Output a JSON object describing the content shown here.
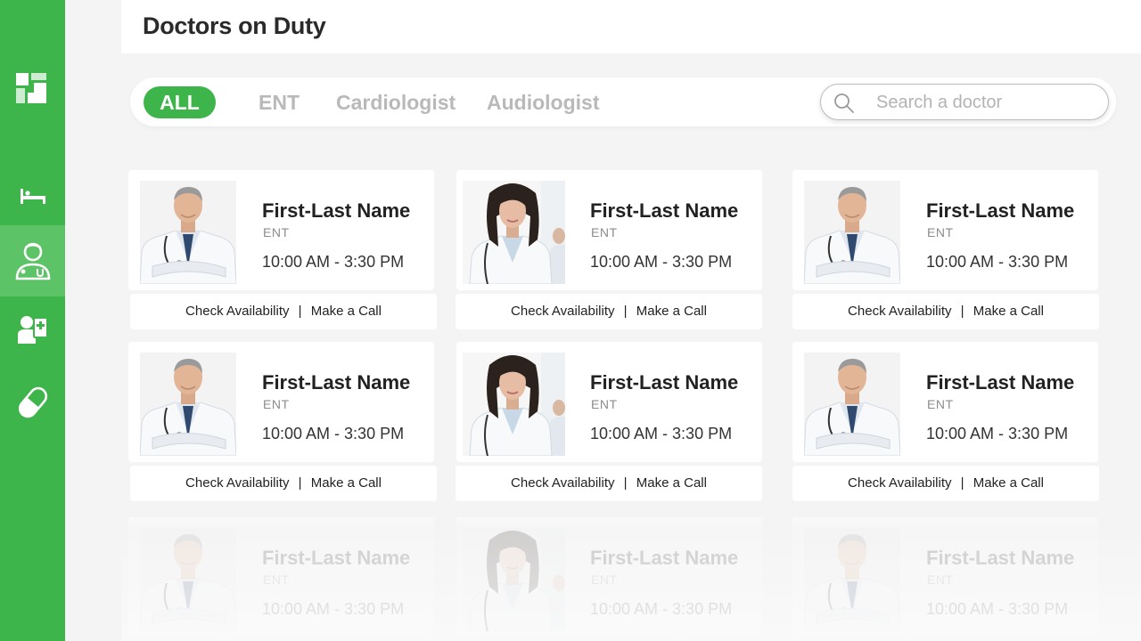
{
  "header": {
    "title": "Doctors on Duty"
  },
  "sidebar": {
    "logo": "app-logo-icon",
    "items": [
      {
        "name": "bed",
        "icon": "bed-icon",
        "active": false
      },
      {
        "name": "doctors",
        "icon": "doctor-icon",
        "active": true
      },
      {
        "name": "patients",
        "icon": "patient-record-icon",
        "active": false
      },
      {
        "name": "medicine",
        "icon": "pill-icon",
        "active": false
      }
    ]
  },
  "filters": {
    "tabs": [
      "ALL",
      "ENT",
      "Cardiologist",
      "Audiologist"
    ],
    "active_tab": "ALL",
    "search_placeholder": "Search a doctor",
    "search_value": ""
  },
  "doctors": [
    {
      "name": "First-Last Name",
      "specialty": "ENT",
      "hours": "10:00 AM - 3:30 PM",
      "photo": "male-doctor-photo"
    },
    {
      "name": "First-Last Name",
      "specialty": "ENT",
      "hours": "10:00 AM - 3:30 PM",
      "photo": "female-doctor-photo"
    },
    {
      "name": "First-Last Name",
      "specialty": "ENT",
      "hours": "10:00 AM - 3:30 PM",
      "photo": "male-doctor-photo"
    },
    {
      "name": "First-Last Name",
      "specialty": "ENT",
      "hours": "10:00 AM - 3:30 PM",
      "photo": "male-doctor-photo"
    },
    {
      "name": "First-Last Name",
      "specialty": "ENT",
      "hours": "10:00 AM - 3:30 PM",
      "photo": "female-doctor-photo"
    },
    {
      "name": "First-Last Name",
      "specialty": "ENT",
      "hours": "10:00 AM - 3:30 PM",
      "photo": "male-doctor-photo"
    },
    {
      "name": "First-Last Name",
      "specialty": "ENT",
      "hours": "10:00 AM - 3:30 PM",
      "photo": "male-doctor-photo"
    },
    {
      "name": "First-Last Name",
      "specialty": "ENT",
      "hours": "10:00 AM - 3:30 PM",
      "photo": "female-doctor-photo"
    },
    {
      "name": "First-Last Name",
      "specialty": "ENT",
      "hours": "10:00 AM - 3:30 PM",
      "photo": "male-doctor-photo"
    }
  ],
  "actions": {
    "check_label": "Check Availability",
    "separator": "|",
    "call_label": "Make a Call"
  },
  "colors": {
    "accent": "#3db54a",
    "accent_light": "#5cc466",
    "background": "#f4f4f4",
    "tab_inactive": "#b9b9b9"
  }
}
